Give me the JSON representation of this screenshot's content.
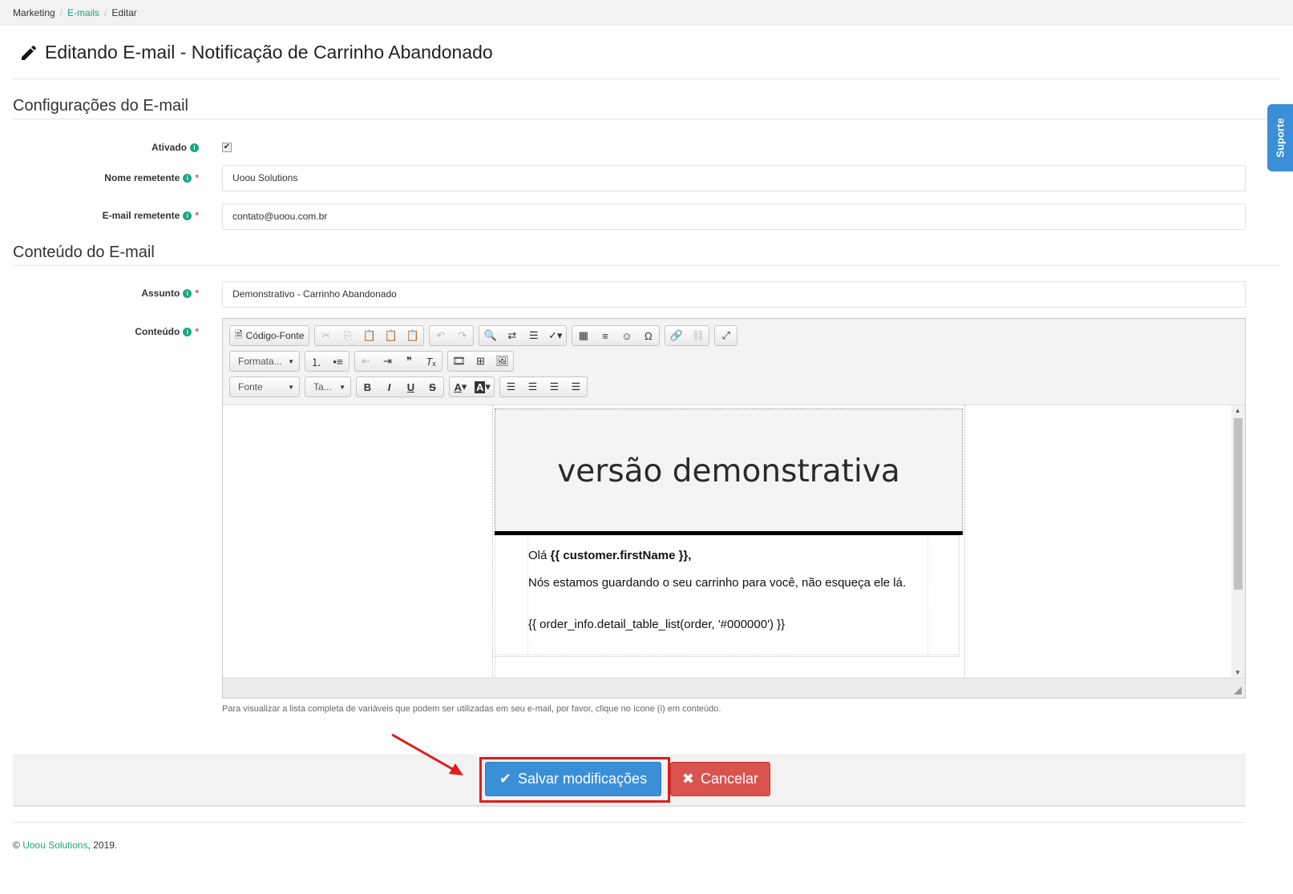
{
  "breadcrumb": {
    "item1": "Marketing",
    "item2": "E-mails",
    "item3": "Editar",
    "sep": "/"
  },
  "page_title": "Editando E-mail - Notificação de Carrinho Abandonado",
  "section_config": "Configurações do E-mail",
  "section_content": "Conteúdo do E-mail",
  "fields": {
    "ativado_label": "Ativado",
    "ativado_checked": true,
    "nome_label": "Nome remetente",
    "nome_value": "Uoou Solutions",
    "email_label": "E-mail remetente",
    "email_value": "contato@uoou.com.br",
    "assunto_label": "Assunto",
    "assunto_value": "Demonstrativo - Carrinho Abandonado",
    "conteudo_label": "Conteúdo",
    "required_mark": "*",
    "info_mark": "i"
  },
  "suporte_tab": "Suporte",
  "editor": {
    "source_button": "Código-Fonte",
    "format_combo": "Formata...",
    "font_combo": "Fonte",
    "size_combo": "Ta...",
    "mail_header": "versão demonstrativa",
    "greeting_prefix": "Olá ",
    "greeting_var": "{{ customer.firstName }},",
    "message": "Nós estamos guardando o seu carrinho para você, não esqueça ele lá.",
    "table_var": "{{ order_info.detail_table_list(order, '#000000') }}"
  },
  "hint": "Para visualizar a lista completa de variáveis que podem ser utilizadas em seu e-mail, por favor, clique no ícone (i) em conteúdo.",
  "buttons": {
    "save": "Salvar modificações",
    "cancel": "Cancelar"
  },
  "footer": {
    "prefix": "© ",
    "company": "Uoou Solutions",
    "suffix": ", 2019."
  }
}
